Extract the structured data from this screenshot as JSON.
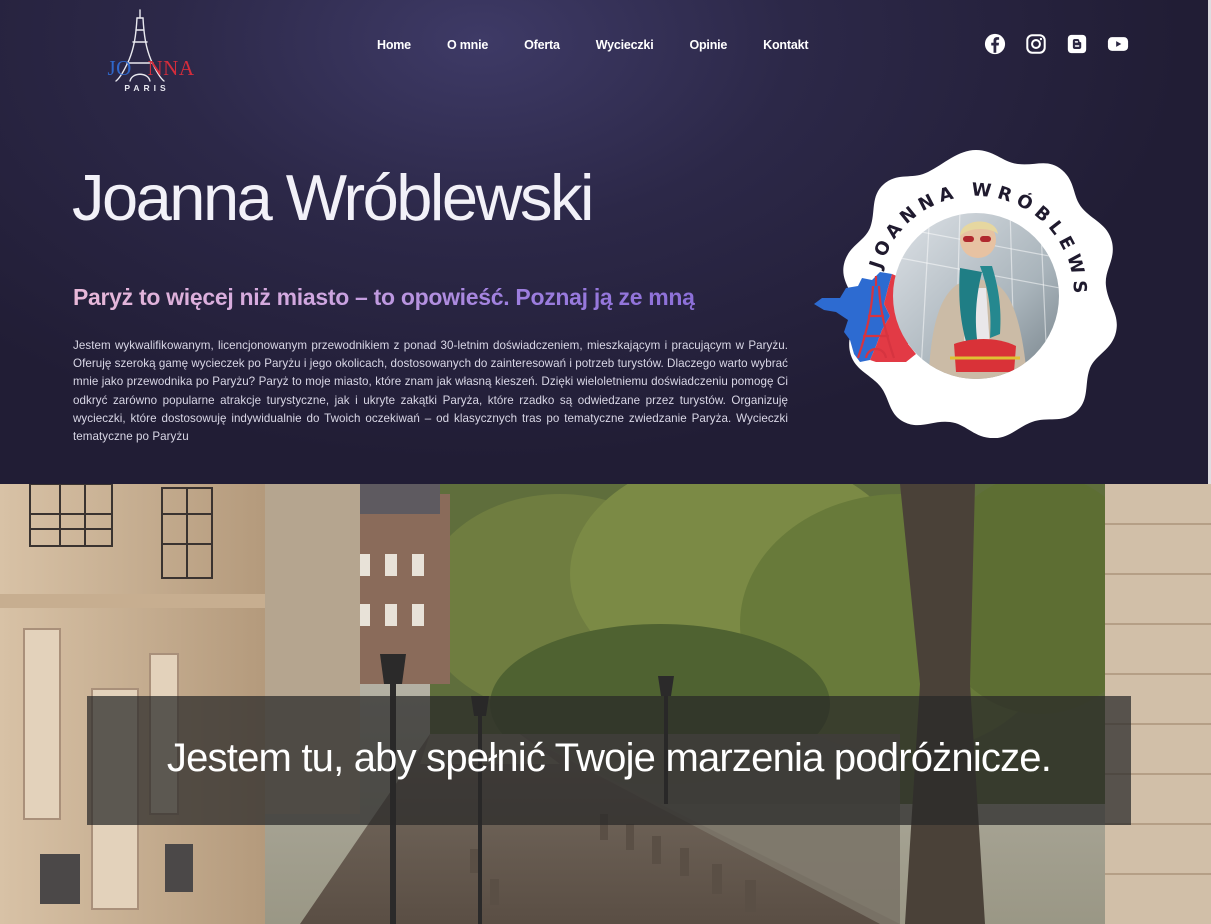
{
  "logo": {
    "word_left": "JO",
    "word_mid": "A",
    "word_right": "NNA",
    "subtitle": "PARIS",
    "colors": {
      "blue": "#2f67c9",
      "white": "#f1f1f1",
      "red": "#d42c3b"
    }
  },
  "nav": {
    "items": [
      {
        "label": "Home"
      },
      {
        "label": "O mnie"
      },
      {
        "label": "Oferta"
      },
      {
        "label": "Wycieczki"
      },
      {
        "label": "Opinie"
      },
      {
        "label": "Kontakt"
      }
    ]
  },
  "socials": [
    {
      "icon": "facebook-icon"
    },
    {
      "icon": "instagram-icon"
    },
    {
      "icon": "blogger-icon"
    },
    {
      "icon": "youtube-icon"
    }
  ],
  "hero": {
    "name": "Joanna Wróblewski",
    "tagline": "Paryż to więcej niż miasto – to opowieść. Poznaj ją ze mną",
    "intro": "Jestem wykwalifikowanym, licencjonowanym przewodnikiem z ponad 30-letnim doświadczeniem, mieszkającym i pracującym w Paryżu. Oferuję szeroką gamę wycieczek po Paryżu i jego okolicach, dostosowanych do zainteresowań i potrzeb turystów. Dlaczego warto wybrać mnie jako przewodnika po Paryżu? Paryż to moje miasto, które znam jak własną kieszeń. Dzięki wieloletniemu doświadczeniu pomogę Ci odkryć zarówno popularne atrakcje turystyczne, jak i ukryte zakątki Paryża, które rzadko są odwiedzane przez turystów. Organizuję wycieczki, które dostosowuję indywidualnie do Twoich oczekiwań – od klasycznych tras po tematyczne zwiedzanie Paryża. Wycieczki tematyczne po Paryżu",
    "badge_text": "JOANNA WRÓBLEWSKI",
    "colors": {
      "bg_top": "#3e3a66",
      "bg_bottom": "#211d35",
      "tagline_start": "#e8b8d8",
      "tagline_end": "#8c6fd8"
    }
  },
  "banner": {
    "quote": "Jestem tu, aby spełnić Twoje marzenia podróżnicze."
  }
}
